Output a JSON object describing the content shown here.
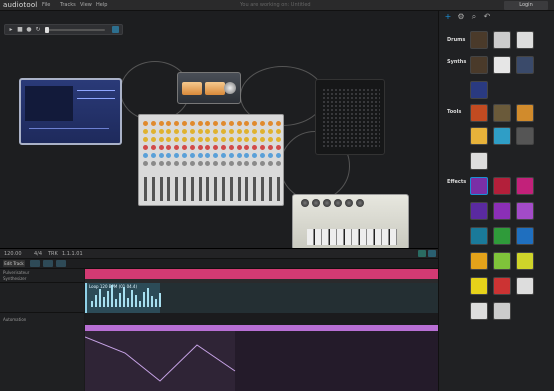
{
  "app": {
    "logo": "audiotool",
    "status_message": "You are working on: Untitled"
  },
  "menu": [
    "File",
    "Tracks",
    "View",
    "Help"
  ],
  "header": {
    "login_label": "Login"
  },
  "sidebar": {
    "categories": [
      "Drums",
      "Synths",
      "Tools",
      "Effects"
    ]
  },
  "sequencer": {
    "bpm": "120.00",
    "sig": "4/4",
    "tab": "TRK",
    "time": "1.1.1.01",
    "edit_label": "Edit Track",
    "tracks": [
      "Pulverisateur",
      "Synthesizer",
      "Automation"
    ],
    "clip_title": "Loop 120 BPM (01 04.4)"
  },
  "colors": {
    "accent": "#1a8fd6",
    "timeline": "#d23a73",
    "automation": "#b86fd4",
    "audio": "#2c4b57"
  },
  "icons": [
    "play-icon",
    "stop-icon",
    "record-icon",
    "undo-icon",
    "settings-icon",
    "search-icon",
    "plus-icon"
  ]
}
